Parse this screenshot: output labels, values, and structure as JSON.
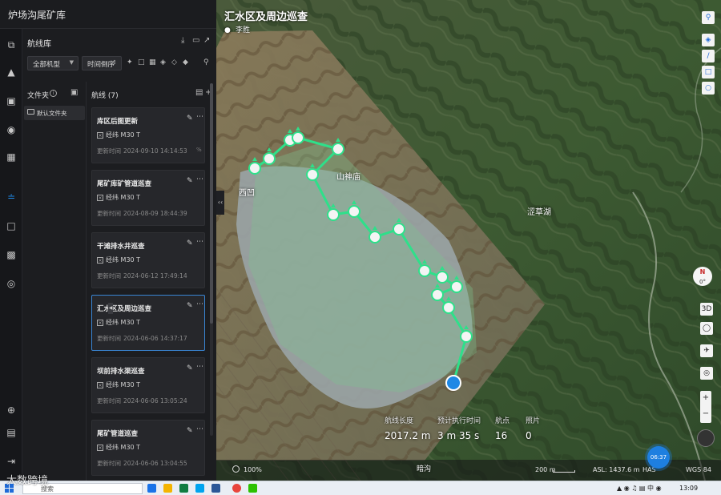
{
  "app": {
    "title": "炉场沟尾矿库"
  },
  "library": {
    "title": "航线库",
    "filter_all": "全部机型",
    "sort_label": "时间倒序",
    "folders_title": "文件夹",
    "default_folder": "默认文件夹",
    "routes_title": "航线 (7)",
    "update_prefix": "更新时间",
    "routes": [
      {
        "name": "库区后图更新",
        "drone": "经纬 M30 T",
        "updated": "2024-09-10 14:14:53",
        "suffix": "%"
      },
      {
        "name": "尾矿库矿管道巡查",
        "drone": "经纬 M30 T",
        "updated": "2024-08-09 18:44:39",
        "suffix": ""
      },
      {
        "name": "干滩排水井巡查",
        "drone": "经纬 M30 T",
        "updated": "2024-06-12 17:49:14",
        "suffix": ""
      },
      {
        "name": "汇水区及周边巡查",
        "drone": "经纬 M30 T",
        "updated": "2024-06-06 14:37:17",
        "suffix": ""
      },
      {
        "name": "坝前排水渠巡查",
        "drone": "经纬 M30 T",
        "updated": "2024-06-06 13:05:24",
        "suffix": ""
      },
      {
        "name": "尾矿管道巡查",
        "drone": "经纬 M30 T",
        "updated": "2024-06-06 13:04:55",
        "suffix": ""
      }
    ]
  },
  "map": {
    "route_title": "汇水区及周边巡查",
    "user": "李胜",
    "labels": {
      "xiao": "西凹",
      "shanshen": "山神庙",
      "sedge_lake": "涩草湖",
      "bottom": "暗沟"
    },
    "stats": [
      {
        "label": "航线长度",
        "value": "2017.2 m"
      },
      {
        "label": "预计执行时间",
        "value": "3 m 35 s"
      },
      {
        "label": "航点",
        "value": "16"
      },
      {
        "label": "照片",
        "value": "0"
      }
    ],
    "zoom": "100%",
    "scale": "200 m",
    "asl": "ASL: 1437.6 m",
    "has": "HAS",
    "wgs": "WGS 84",
    "compass_deg": "0°",
    "rec": "06:37",
    "route_color": "#2ee08a",
    "start_color": "#1e88e5"
  },
  "taskbar": {
    "search_placeholder": "搜索",
    "time": "13:09"
  },
  "watermark": "大数跨境"
}
